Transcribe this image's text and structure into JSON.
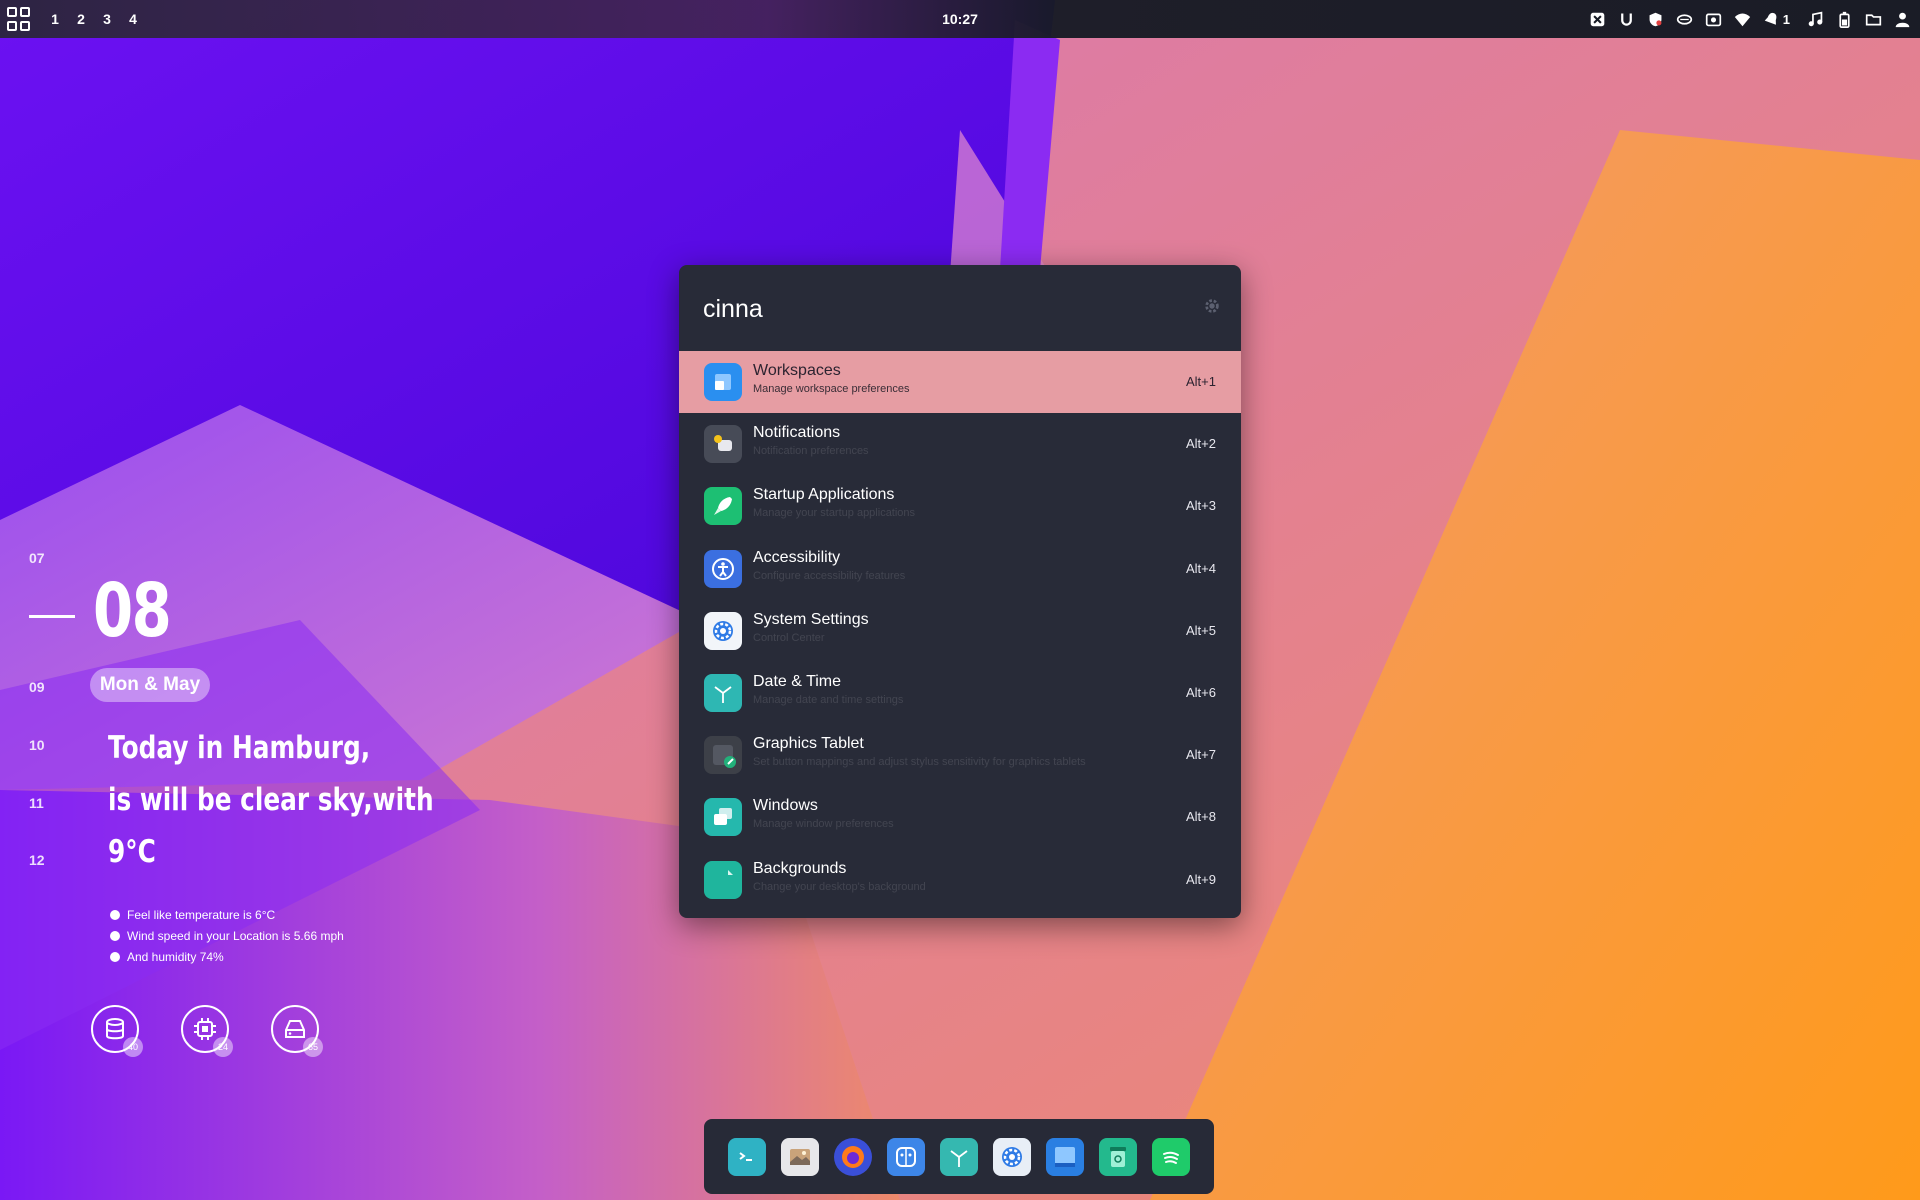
{
  "theme": {
    "panel_bg": "#161a24",
    "launcher_bg": "#282b38",
    "selection": "#e69da3",
    "dock_bg": "#272a37"
  },
  "panel": {
    "workspaces": [
      "1",
      "2",
      "3",
      "4"
    ],
    "clock": "10:27",
    "notification_count": "1",
    "tray_icons": [
      "x-icon",
      "magnet-icon",
      "shield-icon",
      "drive-icon",
      "screenshot-icon",
      "wifi-icon",
      "bell-icon",
      "music-icon",
      "battery-icon",
      "folder-icon",
      "user-icon"
    ]
  },
  "widget": {
    "hours": [
      "07",
      "09",
      "10",
      "11",
      "12"
    ],
    "day": "08",
    "date": "Mon & May",
    "forecast": [
      "Today in Hamburg,",
      "is will be clear sky,with",
      "9°C"
    ],
    "details": [
      "Feel like temperature is 6°C",
      "Wind speed in your Location is 5.66 mph",
      "And humidity 74%"
    ],
    "meters": [
      {
        "icon": "database-icon",
        "value": "40"
      },
      {
        "icon": "cpu-icon",
        "value": "24"
      },
      {
        "icon": "disk-icon",
        "value": "65"
      }
    ]
  },
  "launcher": {
    "query": "cinna",
    "results": [
      {
        "title": "Workspaces",
        "subtitle": "Manage workspace preferences",
        "shortcut": "Alt+1",
        "icon": "workspaces-icon",
        "color": "#2a8ff0"
      },
      {
        "title": "Notifications",
        "subtitle": "Notification preferences",
        "shortcut": "Alt+2",
        "icon": "notifications-icon",
        "color": "#474b57"
      },
      {
        "title": "Startup Applications",
        "subtitle": "Manage your startup applications",
        "shortcut": "Alt+3",
        "icon": "rocket-icon",
        "color": "#1dbf73"
      },
      {
        "title": "Accessibility",
        "subtitle": "Configure accessibility features",
        "shortcut": "Alt+4",
        "icon": "accessibility-icon",
        "color": "#3b6fe0"
      },
      {
        "title": "System Settings",
        "subtitle": "Control Center",
        "shortcut": "Alt+5",
        "icon": "settings-icon",
        "color": "#f2f5f9"
      },
      {
        "title": "Date & Time",
        "subtitle": "Manage date and time settings",
        "shortcut": "Alt+6",
        "icon": "clock-icon",
        "color": "#2eb7b3"
      },
      {
        "title": "Graphics Tablet",
        "subtitle": "Set button mappings and adjust stylus sensitivity for graphics tablets",
        "shortcut": "Alt+7",
        "icon": "tablet-icon",
        "color": "#3d4048"
      },
      {
        "title": "Windows",
        "subtitle": "Manage window preferences",
        "shortcut": "Alt+8",
        "icon": "windows-icon",
        "color": "#25b8ad"
      },
      {
        "title": "Backgrounds",
        "subtitle": "Change your desktop's background",
        "shortcut": "Alt+9",
        "icon": "backgrounds-icon",
        "color": "#1fb59d"
      }
    ]
  },
  "dock": {
    "apps": [
      {
        "icon": "terminal-icon",
        "color": "#2fb2c4"
      },
      {
        "icon": "image-viewer-icon",
        "color": "#e7e7ea"
      },
      {
        "icon": "firefox-icon",
        "color": "#3a4fd8"
      },
      {
        "icon": "finder-icon",
        "color": "#3d86e8"
      },
      {
        "icon": "clock-app-icon",
        "color": "#35b8b0"
      },
      {
        "icon": "settings-app-icon",
        "color": "#e8eef6"
      },
      {
        "icon": "files-icon",
        "color": "#2a7fe2"
      },
      {
        "icon": "trash-icon",
        "color": "#23b98d"
      },
      {
        "icon": "spotify-icon",
        "color": "#1fcb6a"
      }
    ]
  }
}
